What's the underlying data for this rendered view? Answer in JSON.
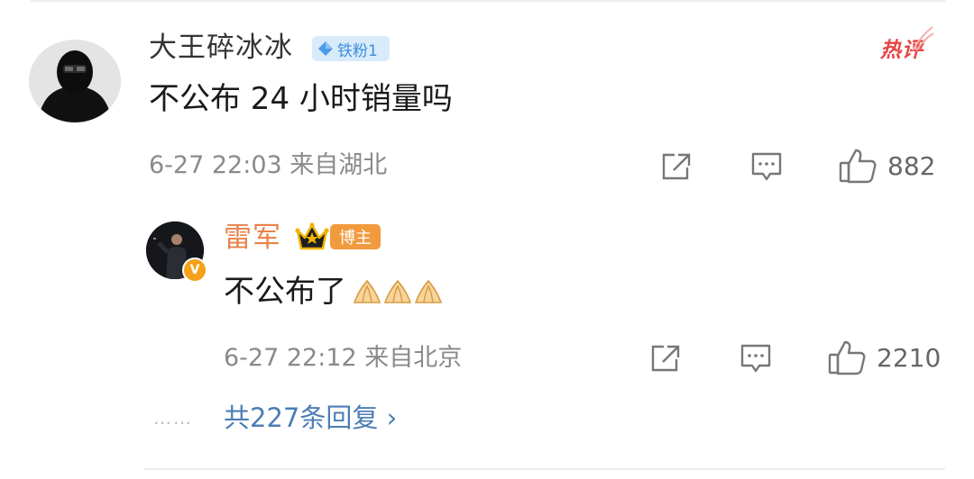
{
  "comment": {
    "username": "大王碎冰冰",
    "fan_badge": "铁粉1",
    "hot_badge": "热评",
    "text": "不公布 24 小时销量吗",
    "meta": "6-27 22:03 来自湖北",
    "like_count": "882"
  },
  "reply": {
    "username": "雷军",
    "role_badge": "博主",
    "verified_mark": "V",
    "text": "不公布了",
    "emoji_name": "pinched-hands-emoji",
    "meta": "6-27 22:12 来自北京",
    "like_count": "2210"
  },
  "more_replies": {
    "dots": "……",
    "label": "共227条回复 ›"
  },
  "colors": {
    "reply_name": "#e8834a",
    "link": "#4c7db5",
    "hot": "#e64545",
    "fan_badge_bg": "#d9ebfb",
    "fan_badge_text": "#3b8ede",
    "blogger_badge_bg": "#f19a3e",
    "meta_text": "#8a8a8a"
  }
}
